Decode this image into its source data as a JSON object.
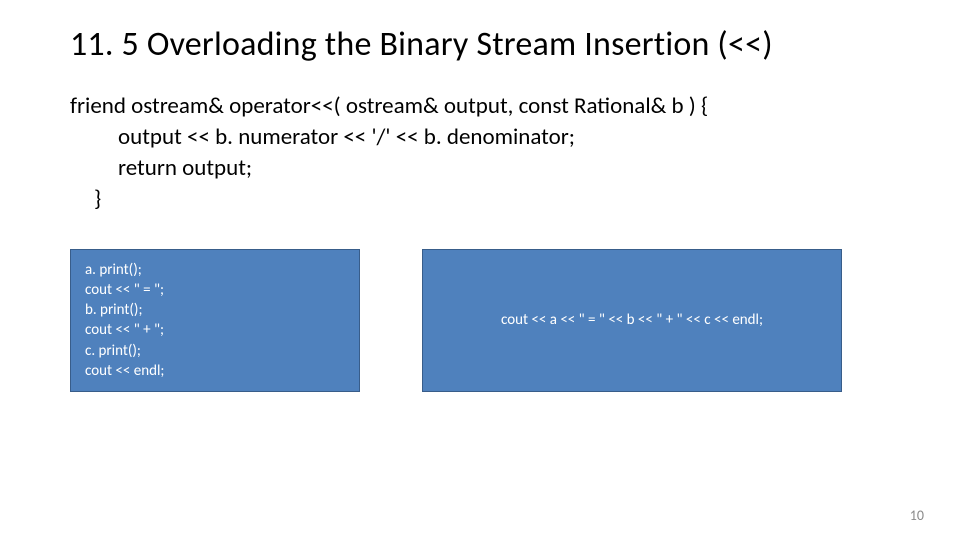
{
  "title": "11. 5 Overloading the Binary Stream Insertion (<<)",
  "code": {
    "line1": "friend ostream& operator<<( ostream& output, const Rational& b ) {",
    "line2": "output << b. numerator << '/' << b. denominator;",
    "line3": "return output;",
    "line4": "}"
  },
  "box_left": {
    "l1": "a. print();",
    "l2": "cout << \" = \";",
    "l3": "b. print();",
    "l4": "cout << \" + \";",
    "l5": "c. print();",
    "l6": "cout << endl;"
  },
  "box_right": {
    "l1": "cout << a << \" = \" << b << \" + \" << c << endl;"
  },
  "page_number": "10"
}
